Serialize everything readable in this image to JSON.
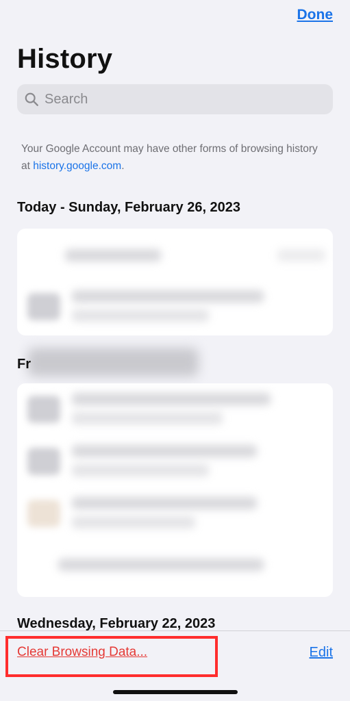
{
  "header": {
    "done_label": "Done",
    "title": "History"
  },
  "search": {
    "placeholder": "Search",
    "icon": "search-icon"
  },
  "info": {
    "text": "Your Google Account may have other forms of browsing history at ",
    "link": "history.google.com",
    "suffix": "."
  },
  "sections": [
    {
      "label": "Today - Sunday, February 26, 2023"
    },
    {
      "label": "Fr"
    },
    {
      "label": "Wednesday, February 22, 2023"
    }
  ],
  "footer": {
    "clear_label": "Clear Browsing Data...",
    "edit_label": "Edit"
  },
  "colors": {
    "accent": "#1a73e8",
    "destructive": "#e53935",
    "highlight_box": "#ff2d2d"
  }
}
